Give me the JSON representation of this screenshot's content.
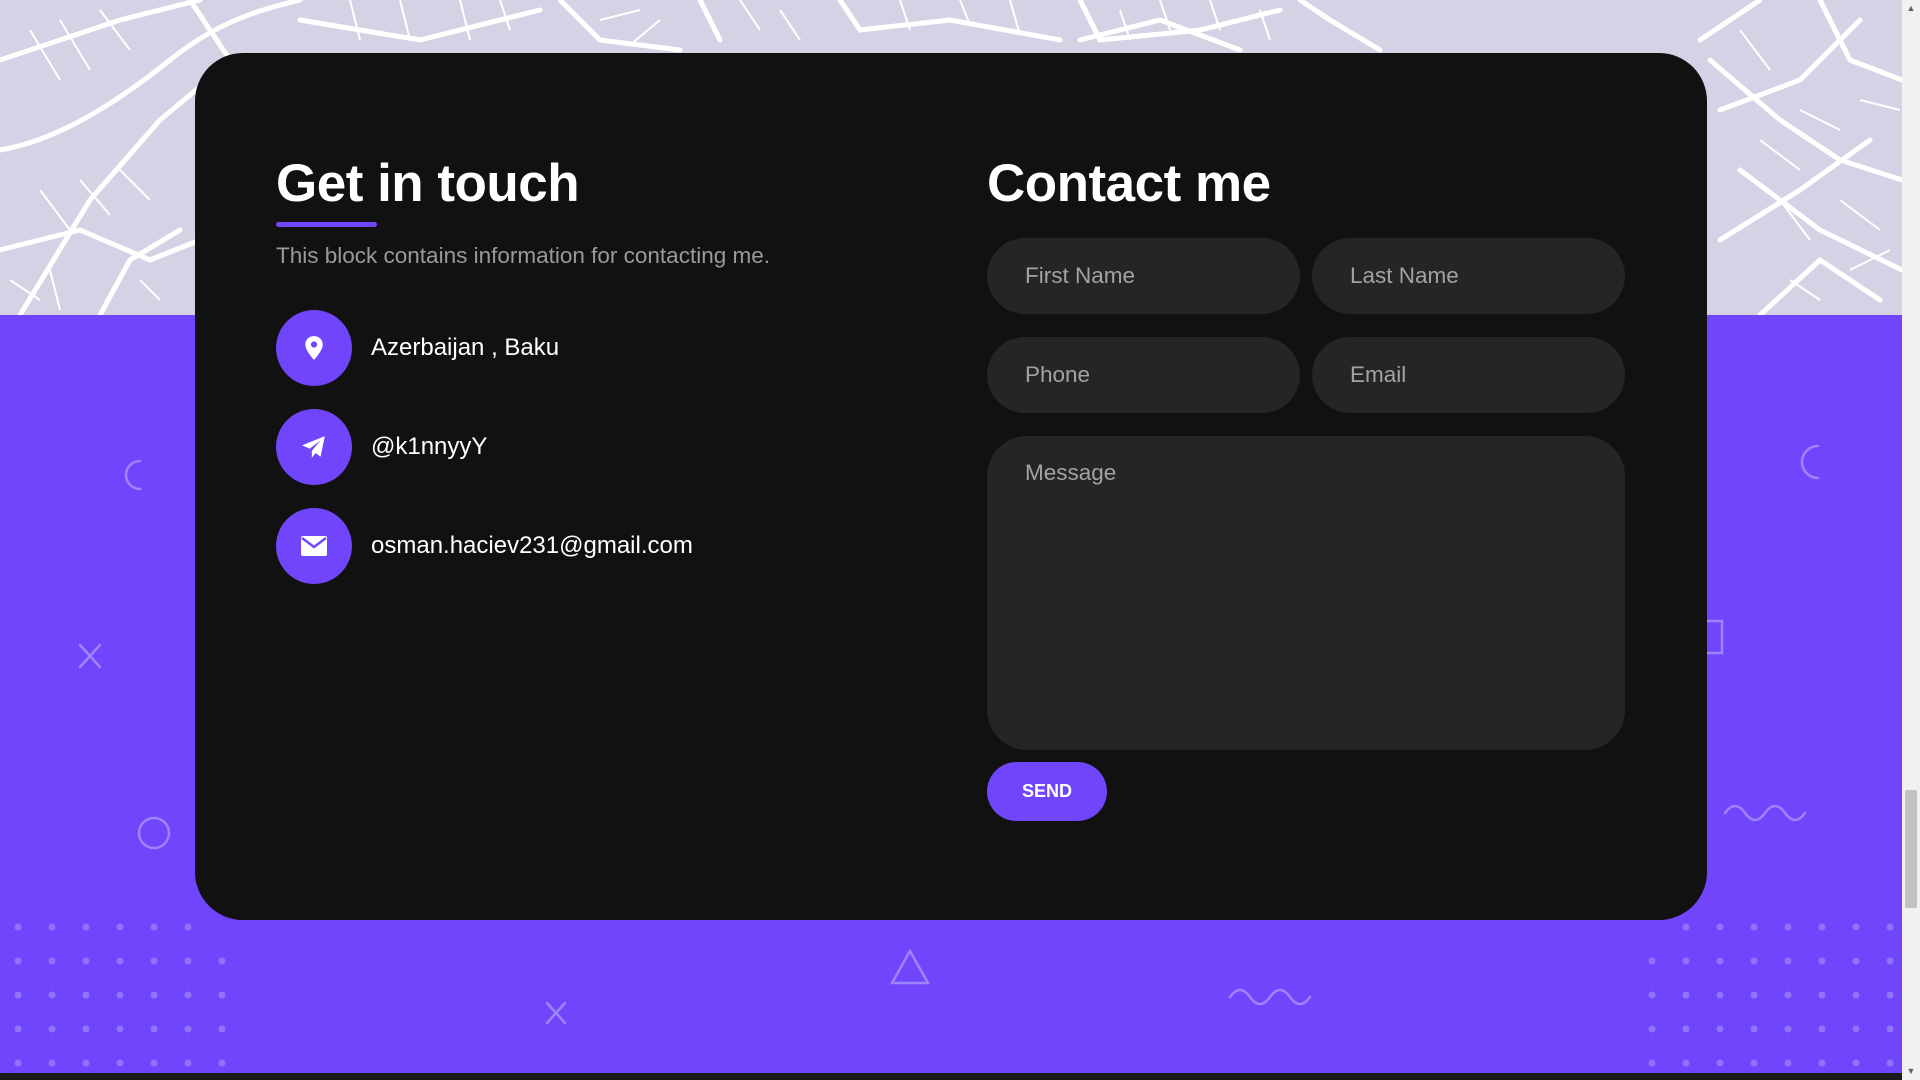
{
  "contact_info": {
    "title": "Get in touch",
    "description": "This block contains information for contacting me.",
    "items": [
      {
        "icon": "map-pin-icon",
        "text": "Azerbaijan , Baku"
      },
      {
        "icon": "paper-plane-icon",
        "text": "@k1nnyyY"
      },
      {
        "icon": "envelope-icon",
        "text": "osman.haciev231@gmail.com"
      }
    ]
  },
  "contact_form": {
    "title": "Contact me",
    "first_name_placeholder": "First Name",
    "last_name_placeholder": "Last Name",
    "phone_placeholder": "Phone",
    "email_placeholder": "Email",
    "message_placeholder": "Message",
    "send_label": "SEND"
  },
  "colors": {
    "accent": "#7145fb",
    "card_background": "#111111",
    "field_background": "#252525",
    "map_background": "#d6d2e6"
  }
}
